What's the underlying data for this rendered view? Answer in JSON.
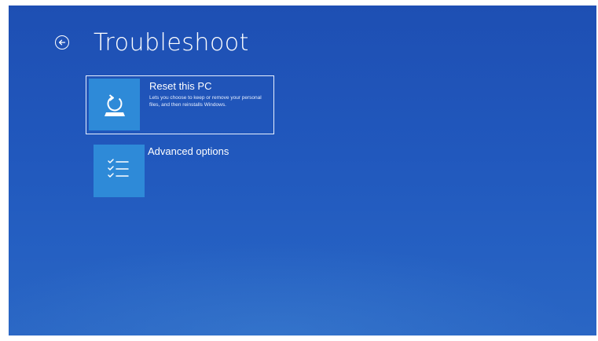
{
  "page": {
    "title": "Troubleshoot"
  },
  "options": [
    {
      "title": "Reset this PC",
      "description": "Lets you choose to keep or remove your personal files, and then reinstalls Windows.",
      "icon": "reset-pc-icon",
      "selected": true
    },
    {
      "title": "Advanced options",
      "description": "",
      "icon": "checklist-icon",
      "selected": false
    }
  ],
  "colors": {
    "background": "#2158bd",
    "tile_icon_background": "#2e8ad8",
    "text": "#ffffff"
  }
}
